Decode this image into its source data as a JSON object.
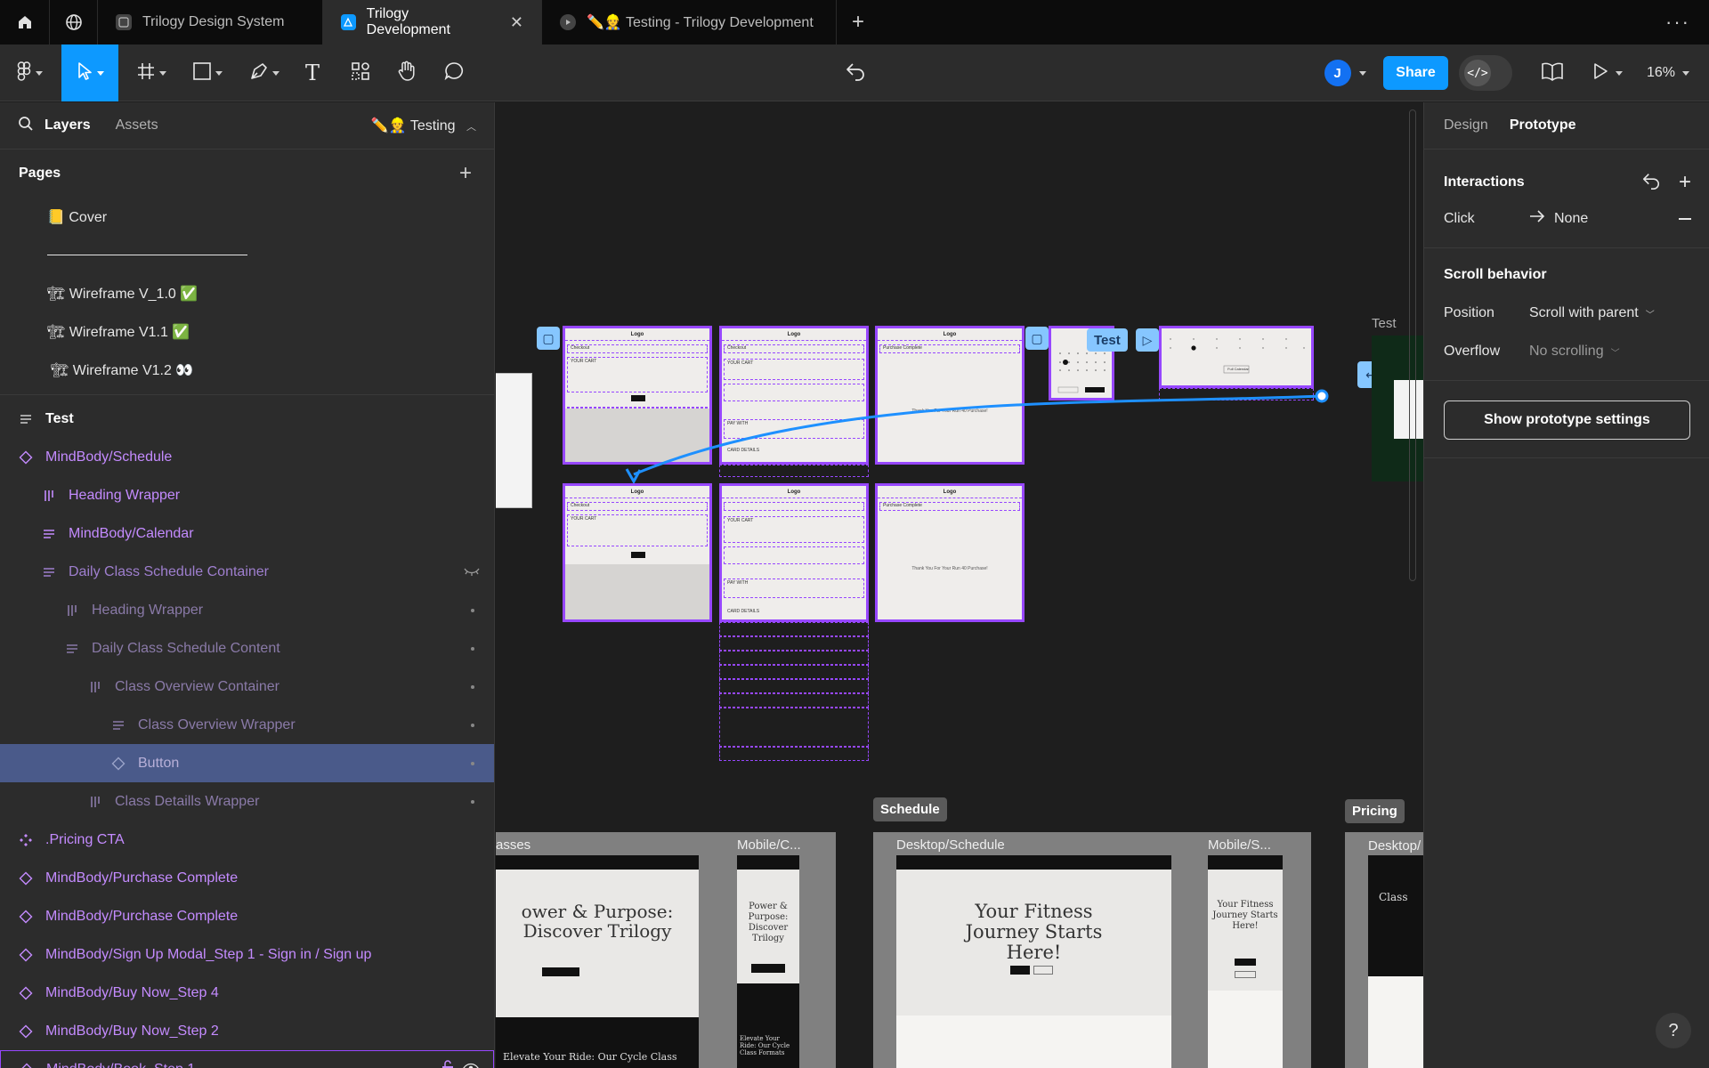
{
  "tabs": [
    {
      "label": "Trilogy Design System",
      "active": false
    },
    {
      "label": "Trilogy Development",
      "active": true
    },
    {
      "label": "✏️👷 Testing - Trilogy Development",
      "active": false
    }
  ],
  "toolbar": {
    "share_label": "Share",
    "zoom": "16%",
    "avatar_initial": "J",
    "dev_mode_glyph": "</>",
    "text_tool_glyph": "T"
  },
  "left_panel": {
    "tab_layers": "Layers",
    "tab_assets": "Assets",
    "current_page": "✏️👷 Testing",
    "pages_title": "Pages",
    "pages": [
      {
        "label": "📒 Cover",
        "indent": 53
      },
      {
        "label": "🏗 Wireframe V_1.0 ✅",
        "indent": 53
      },
      {
        "label": "🏗 Wireframe V1.1 ✅",
        "indent": 53
      },
      {
        "label": "🏗 Wireframe V1.2 👀",
        "indent": 57
      }
    ],
    "layers": [
      {
        "label": "Test",
        "icon": "frame-auto-layout-icon",
        "style": "top",
        "indent": 0
      },
      {
        "label": "MindBody/Schedule",
        "icon": "component-instance-icon",
        "style": "comp",
        "indent": 0
      },
      {
        "label": "Heading Wrapper",
        "icon": "horizontal-layout-icon",
        "style": "comp",
        "indent": 1
      },
      {
        "label": "MindBody/Calendar",
        "icon": "vertical-layout-icon",
        "style": "comp",
        "indent": 1
      },
      {
        "label": "Daily Class Schedule Container",
        "icon": "vertical-layout-icon",
        "style": "dim",
        "indent": 1,
        "hidden": true
      },
      {
        "label": "Heading Wrapper",
        "icon": "horizontal-layout-icon",
        "style": "faint",
        "indent": 2
      },
      {
        "label": "Daily Class Schedule Content",
        "icon": "vertical-layout-icon",
        "style": "faint",
        "indent": 2
      },
      {
        "label": "Class Overview Container",
        "icon": "horizontal-layout-icon",
        "style": "faint",
        "indent": 3
      },
      {
        "label": "Class Overview Wrapper",
        "icon": "vertical-layout-icon",
        "style": "faint",
        "indent": 4
      },
      {
        "label": "Button",
        "icon": "component-instance-icon",
        "style": "selected",
        "indent": 4
      },
      {
        "label": "Class Detaills Wrapper",
        "icon": "horizontal-layout-icon",
        "style": "faint",
        "indent": 3
      },
      {
        "label": ".Pricing CTA",
        "icon": "component-set-icon",
        "style": "comp",
        "indent": 0
      },
      {
        "label": "MindBody/Purchase Complete",
        "icon": "component-instance-icon",
        "style": "comp",
        "indent": 0
      },
      {
        "label": "MindBody/Purchase Complete",
        "icon": "component-instance-icon",
        "style": "comp",
        "indent": 0
      },
      {
        "label": "MindBody/Sign Up Modal_Step 1 - Sign in / Sign up",
        "icon": "component-instance-icon",
        "style": "comp",
        "indent": 0
      },
      {
        "label": "MindBody/Buy Now_Step 4",
        "icon": "component-instance-icon",
        "style": "comp",
        "indent": 0
      },
      {
        "label": "MindBody/Buy Now_Step 2",
        "icon": "component-instance-icon",
        "style": "comp",
        "indent": 0
      },
      {
        "label": "MindBody/Book_Step 1",
        "icon": "component-instance-icon",
        "style": "comp",
        "indent": 0
      }
    ]
  },
  "canvas": {
    "test_label": "Test",
    "test_frame_label": "Test",
    "wire_logo": "Logo",
    "wire_checkout": "Checkout",
    "wire_your_cart": "YOUR CART",
    "wire_purchase_complete": "Purchase Complete",
    "wire_thank_you": "Thank You For Your Run 40 Purchase!",
    "wire_pay_with": "PAY WITH",
    "wire_card_details": "CARD DETAILS",
    "wire_full_calendar": "Full Calendar",
    "section_schedule": "Schedule",
    "section_pricing": "Pricing",
    "frame_classes": "asses",
    "frame_mobile_c": "Mobile/C...",
    "frame_desktop_schedule": "Desktop/Schedule",
    "frame_mobile_s": "Mobile/S...",
    "frame_desktop_pricing": "Desktop/",
    "hero_classes": "ower & Purpose: Discover Trilogy",
    "hero_classes_mobile": "Power & Purpose: Discover Trilogy",
    "hero_schedule": "Your Fitness Journey Starts Here!",
    "hero_schedule_mobile": "Your Fitness Journey Starts Here!",
    "hero_pricing": "Class",
    "bottom_classes": "Elevate Your Ride: Our Cycle Class",
    "bottom_classes_mobile": "Elevate Your Ride: Our Cycle Class Formats"
  },
  "right_panel": {
    "tab_design": "Design",
    "tab_prototype": "Prototype",
    "interactions_title": "Interactions",
    "click_label": "Click",
    "click_value": "None",
    "scroll_title": "Scroll behavior",
    "position_label": "Position",
    "position_value": "Scroll with parent",
    "overflow_label": "Overflow",
    "overflow_value": "No scrolling",
    "show_settings": "Show prototype settings",
    "help": "?"
  },
  "colors": {
    "accent": "#0d99ff",
    "frame_purple": "#9747ff",
    "component_text": "#c48bff",
    "selected_row": "#4a5a8a",
    "connector": "#1e90ff"
  }
}
